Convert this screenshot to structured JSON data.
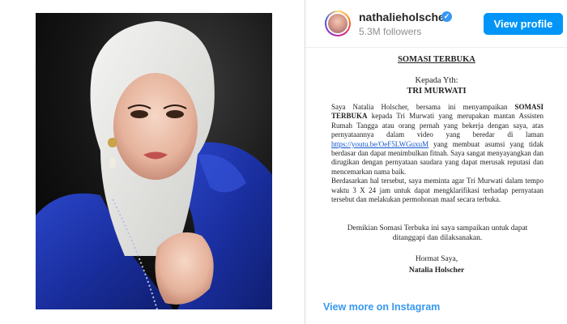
{
  "profile": {
    "username": "nathalieholscher",
    "followers": "5.3M followers",
    "view_profile_label": "View profile"
  },
  "document": {
    "title": "SOMASI TERBUKA",
    "kepada": "Kepada Yth:",
    "recipient": "TRI MURWATI",
    "para1_a": "Saya Natalia Holscher, bersama ini menyampaikan ",
    "para1_bold": "SOMASI TERBUKA",
    "para1_b": " kepada Tri Murwati yang merupakan mantan Assisten Rumah Tangga atau orang pernah yang bekerja dengan saya, atas pernyataannya dalam video yang beredar di laman ",
    "link": "https://youtu.be/OeF5LWGuxuM",
    "para1_c": " yang membuat asumsi yang tidak berdasar dan dapat menimbulkan fitnah. Saya sangat menyayangkan dan dirugikan dengan pernyataan saudara yang dapat merusak reputasi dan mencemarkan nama baik.",
    "para2": "Berdasarkan hal tersebut, saya meminta agar Tri Murwati dalam tempo waktu 3 X 24 jam untuk dapat mengklarifikasi terhadap pernyataan tersebut dan melakukan permohonan maaf secara terbuka.",
    "closing": "Demikian Somasi Terbuka ini saya sampaikan untuk dapat ditanggapi dan dilaksanakan.",
    "signoff": "Hormat Saya,",
    "signer": "Natalia Holscher"
  },
  "footer": {
    "view_more_label": "View more on Instagram"
  },
  "colors": {
    "accent": "#0095f6",
    "link": "#3897f0",
    "verified": "#3897f0"
  }
}
